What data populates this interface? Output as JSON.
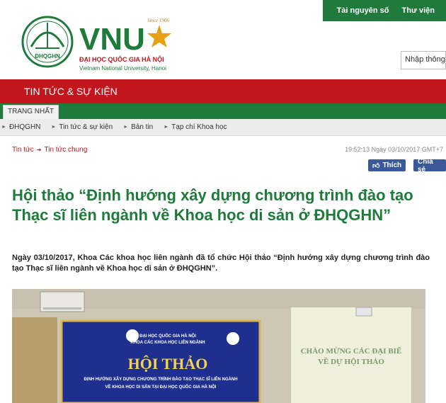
{
  "top_links": {
    "resources": "Tài nguyên số",
    "library": "Thư viện"
  },
  "logo": {
    "vnu": "VNU",
    "seal": "ĐHQGHN",
    "since": "Since 1906",
    "name_vi": "ĐẠI HỌC QUỐC GIA HÀ NỘI",
    "name_en": "Vietnam National University, Hanoi"
  },
  "search": {
    "placeholder": "Nhập thông"
  },
  "section_title": "TIN TỨC & SỰ KIỆN",
  "home_tab": "TRANG NHẤT",
  "subnav": [
    {
      "label": "ĐHQGHN"
    },
    {
      "label": "Tin tức & sự kiện"
    },
    {
      "label": "Bản tin"
    },
    {
      "label": "Tạp chí Khoa học"
    }
  ],
  "breadcrumb": {
    "level1": "Tin tức",
    "level2": "Tin tức chung"
  },
  "timestamp": "19:52:13 Ngày 03/10/2017 GMT+7",
  "social": {
    "like": "Thích",
    "share": "Chia sẻ"
  },
  "article": {
    "title": "Hội thảo “Định hướng xây dựng chương trình đào tạo Thạc sĩ liên ngành về Khoa học di sản ở ĐHQGHN”",
    "lead": "Ngày 03/10/2017, Khoa Các khoa học liên ngành đã tổ chức Hội thảo “Định hướng xây dựng chương trình đào tạo Thạc sĩ liên ngành về Khoa học di sản ở ĐHQGHN”."
  },
  "photo_text": {
    "banner_line1": "ĐẠI HỌC QUỐC GIA HÀ NỘI",
    "banner_line2": "KHOA CÁC KHOA HỌC LIÊN NGÀNH",
    "banner_title": "HỘI THẢO",
    "banner_sub1": "ĐỊNH HƯỚNG XÂY DỰNG CHƯƠNG TRÌNH ĐÀO TẠO THẠC SĨ LIÊN NGÀNH",
    "banner_sub2": "VỀ KHOA HỌC DI SẢN TẠI ĐẠI HỌC QUỐC GIA HÀ NỘI",
    "screen_line1": "CHÀO MỪNG CÁC ĐẠI BIỂ",
    "screen_line2": "VỀ DỰ HỘI THẢO"
  },
  "colors": {
    "green": "#1f7a3b",
    "red": "#c3161c",
    "facebook": "#3b5998"
  }
}
